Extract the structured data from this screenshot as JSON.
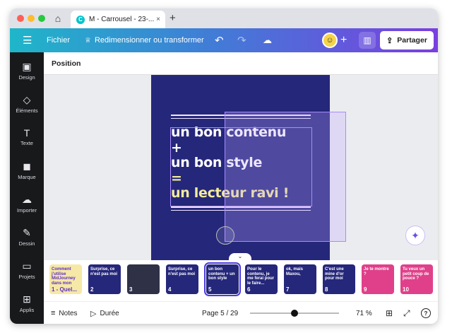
{
  "browser": {
    "tab_icon": "C",
    "tab_title": "M - Carrousel - 23-...",
    "tab_close": "×",
    "new_tab": "+",
    "home_icon": "⌂"
  },
  "toolbar": {
    "menu_icon": "☰",
    "file_label": "Fichier",
    "resize_icon": "♕",
    "resize_label": "Redimensionner ou transformer",
    "undo_icon": "↶",
    "redo_icon": "↷",
    "cloud_icon": "☁",
    "add_icon": "+",
    "stats_icon": "▥",
    "share_icon": "⇪",
    "share_label": "Partager"
  },
  "sidebar": {
    "items": [
      {
        "icon": "▣",
        "label": "Design"
      },
      {
        "icon": "◇",
        "label": "Éléments"
      },
      {
        "icon": "T",
        "label": "Texte"
      },
      {
        "icon": "◼",
        "label": "Marque"
      },
      {
        "icon": "☁",
        "label": "Importer"
      },
      {
        "icon": "✎",
        "label": "Dessin"
      },
      {
        "icon": "▭",
        "label": "Projets"
      },
      {
        "icon": "⊞",
        "label": "Applis"
      }
    ]
  },
  "context_bar": {
    "label": "Position"
  },
  "canvas": {
    "line1": "un bon contenu",
    "line2": "+",
    "line3": "un bon style",
    "line4": "=",
    "line5": "un lecteur ravi !",
    "magic_icon": "✦",
    "collapse_icon": "⌄",
    "colors": {
      "page_bg": "#25277a",
      "highlight": "#f4ec9a",
      "selection": "#a98bff"
    }
  },
  "pages": [
    {
      "num": "1 - Quel...",
      "text": "Comment j'utilise MidJourney dans mon",
      "bg": "#f6e8a6",
      "fg": "#5b2ec7"
    },
    {
      "num": "2",
      "text": "Surprise, ce n'est pas moi",
      "bg": "#25277a",
      "fg": "#ffffff"
    },
    {
      "num": "3",
      "text": "",
      "bg": "#2f3147",
      "fg": "#ffffff"
    },
    {
      "num": "4",
      "text": "Surprise, ce n'est pas moi",
      "bg": "#25277a",
      "fg": "#ffffff"
    },
    {
      "num": "5",
      "text": "un bon contenu + un bon style",
      "bg": "#25277a",
      "fg": "#ffffff"
    },
    {
      "num": "6",
      "text": "Pour le contenu, je me ferai pour le faire...",
      "bg": "#25277a",
      "fg": "#ffffff"
    },
    {
      "num": "7",
      "text": "ok, mais Maxou,",
      "bg": "#25277a",
      "fg": "#ffffff"
    },
    {
      "num": "8",
      "text": "C'est une mine d'or pour moi",
      "bg": "#25277a",
      "fg": "#ffffff"
    },
    {
      "num": "9",
      "text": "Je te montre ?",
      "bg": "#e0408a",
      "fg": "#ffffff"
    },
    {
      "num": "10",
      "text": "Tu veux un petit coup de pouce ?",
      "bg": "#e0408a",
      "fg": "#ffffff"
    }
  ],
  "bottom": {
    "notes_icon": "≡",
    "notes_label": "Notes",
    "duration_icon": "▷",
    "duration_label": "Durée",
    "page_counter": "Page 5 / 29",
    "zoom_label": "71 %",
    "zoom_fraction": 0.5,
    "grid_icon": "⊞",
    "expand_icon": "⤢",
    "help_icon": "?"
  }
}
